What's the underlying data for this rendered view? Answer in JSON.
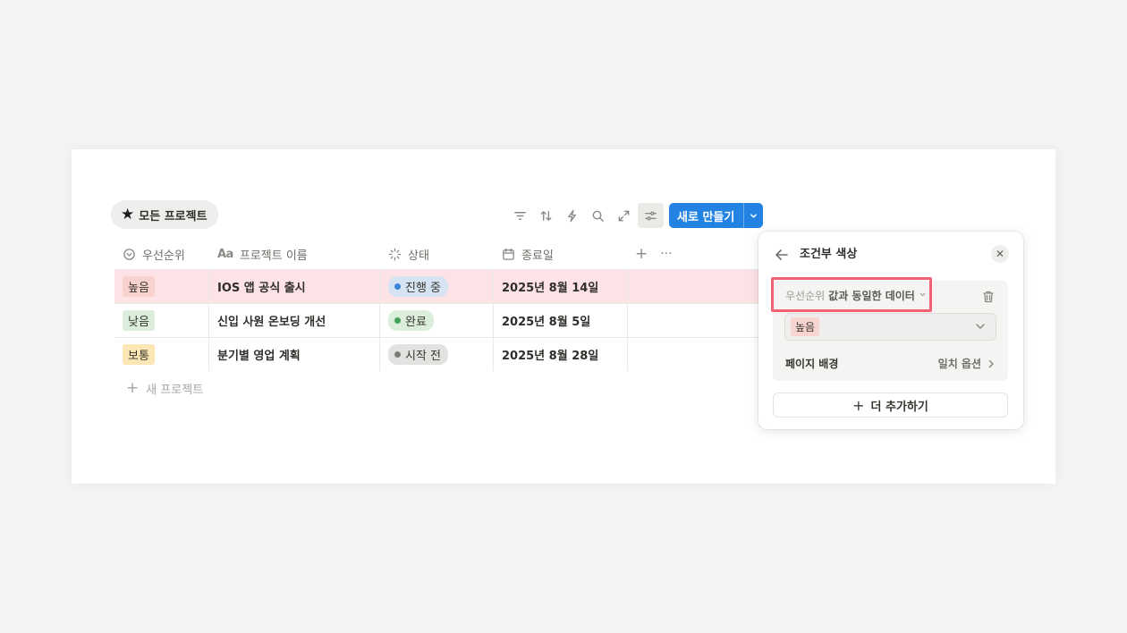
{
  "view": {
    "star_icon": "star-icon",
    "tab_label": "모든 프로젝트"
  },
  "toolbar": {
    "new_label": "새로 만들기",
    "accent": "#2383e2"
  },
  "table": {
    "headers": {
      "priority": "우선순위",
      "name_prefix": "Aa",
      "name": "프로젝트 이름",
      "status": "상태",
      "due": "종료일"
    },
    "rows": [
      {
        "priority": "높음",
        "name": "IOS 앱 공식 출시",
        "status": "진행 중",
        "due": "2025년 8월 14일"
      },
      {
        "priority": "낮음",
        "name": "신입 사원 온보딩 개선",
        "status": "완료",
        "due": "2025년 8월 5일"
      },
      {
        "priority": "보통",
        "name": "분기별 영업 계획",
        "status": "시작 전",
        "due": "2025년 8월 28일"
      }
    ],
    "new_row_label": "새 프로젝트",
    "highlight_color": "#fde3e6"
  },
  "panel": {
    "title": "조건부 색상",
    "condition_field": "우선순위",
    "condition_text": "값과 동일한 데이터",
    "selected_value": "높음",
    "bg_label": "페이지 배경",
    "bg_value": "일치 옵션",
    "add_label": "더 추가하기"
  }
}
